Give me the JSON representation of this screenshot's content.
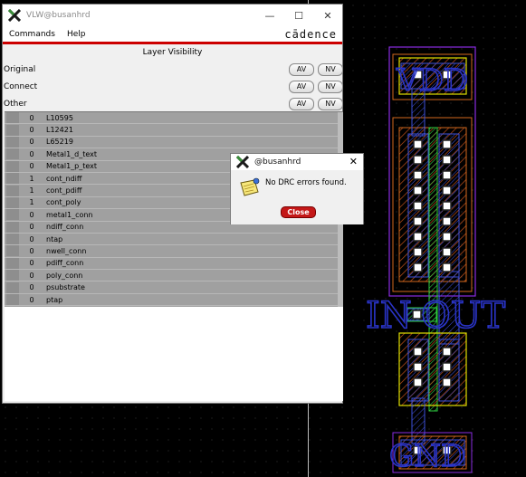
{
  "vlw_window": {
    "title": "VLW@busanhrd",
    "controls": {
      "minimize": "—",
      "maximize": "☐",
      "close": "✕"
    },
    "menu": [
      "Commands",
      "Help"
    ],
    "brand": "cādence",
    "section_title": "Layer Visibility",
    "visibility_rows": [
      {
        "label": "Original",
        "av": "AV",
        "nv": "NV"
      },
      {
        "label": "Connect",
        "av": "AV",
        "nv": "NV"
      },
      {
        "label": "Other",
        "av": "AV",
        "nv": "NV"
      }
    ],
    "layers": [
      {
        "count": "0",
        "name": "L10595"
      },
      {
        "count": "0",
        "name": "L12421"
      },
      {
        "count": "0",
        "name": "L65219"
      },
      {
        "count": "0",
        "name": "Metal1_d_text"
      },
      {
        "count": "0",
        "name": "Metal1_p_text"
      },
      {
        "count": "1",
        "name": "cont_ndiff"
      },
      {
        "count": "1",
        "name": "cont_pdiff"
      },
      {
        "count": "1",
        "name": "cont_poly"
      },
      {
        "count": "0",
        "name": "metal1_conn"
      },
      {
        "count": "0",
        "name": "ndiff_conn"
      },
      {
        "count": "0",
        "name": "ntap"
      },
      {
        "count": "0",
        "name": "nwell_conn"
      },
      {
        "count": "0",
        "name": "pdiff_conn"
      },
      {
        "count": "0",
        "name": "poly_conn"
      },
      {
        "count": "0",
        "name": "psubstrate"
      },
      {
        "count": "0",
        "name": "ptap"
      }
    ]
  },
  "drc_dialog": {
    "title": "@busanhrd",
    "close_x": "✕",
    "message": "No DRC errors found.",
    "close_button": "Close"
  },
  "layout": {
    "labels": {
      "vdd": "VDD",
      "in": "IN",
      "out": "OUT",
      "gnd": "GND"
    },
    "colors": {
      "nwell": "#8a2be2",
      "pselect": "#d2691e",
      "nselect": "#d2691e",
      "diffusion": "#e0e000",
      "poly": "#22aa22",
      "metal1": "#3d4fd8",
      "contact": "#ffffff"
    }
  }
}
